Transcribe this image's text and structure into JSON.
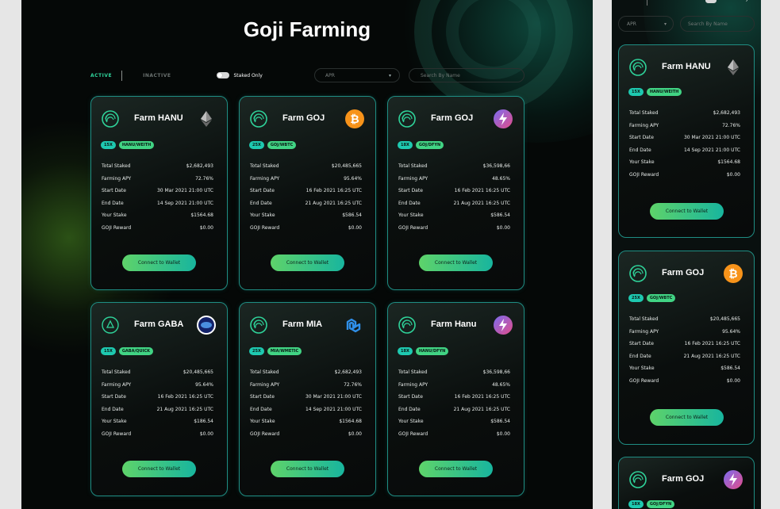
{
  "page": {
    "title": "Goji Farming"
  },
  "filters": {
    "active_label": "ACTIVE",
    "inactive_label": "INACTIVE",
    "staked_only_label": "Staked Only",
    "sort_value": "APR",
    "search_placeholder": "Search By Name"
  },
  "row_labels": {
    "total_staked": "Total Staked",
    "farming_apy": "Farming APY",
    "start_date": "Start Date",
    "end_date": "End Date",
    "your_stake": "Your Stake",
    "goji_reward": "GOJI Reward"
  },
  "connect_label": "Connect to Wallet",
  "cards": [
    {
      "name": "Farm HANU",
      "multiplier": "15X",
      "pair": "HANU/WEITH",
      "token_icon": "ethereum-icon",
      "total_staked": "$2,682,493",
      "farming_apy": "72.76%",
      "start_date": "30 Mar 2021 21:00 UTC",
      "end_date": "14 Sep 2021 21:00 UTC",
      "your_stake": "$1564.68",
      "goji_reward": "$0.00"
    },
    {
      "name": "Farm GOJ",
      "multiplier": "25X",
      "pair": "GOJ/WBTC",
      "token_icon": "bitcoin-icon",
      "total_staked": "$20,485,665",
      "farming_apy": "95.64%",
      "start_date": "16 Feb 2021 16:25 UTC",
      "end_date": "21 Aug 2021 16:25 UTC",
      "your_stake": "$586.54",
      "goji_reward": "$0.00"
    },
    {
      "name": "Farm GOJ",
      "multiplier": "18X",
      "pair": "GOJ/DFYN",
      "token_icon": "dfyn-icon",
      "total_staked": "$36,598,66",
      "farming_apy": "48.65%",
      "start_date": "16 Feb 2021 16:25 UTC",
      "end_date": "21 Aug 2021 16:25 UTC",
      "your_stake": "$586.54",
      "goji_reward": "$0.00"
    },
    {
      "name": "Farm GABA",
      "multiplier": "15X",
      "pair": "GABA/QUICK",
      "token_icon": "quickswap-icon",
      "total_staked": "$20,485,665",
      "farming_apy": "95.64%",
      "start_date": "16 Feb 2021 16:25 UTC",
      "end_date": "21 Aug 2021 16:25 UTC",
      "your_stake": "$186.54",
      "goji_reward": "$0.00"
    },
    {
      "name": "Farm MIA",
      "multiplier": "25X",
      "pair": "MIA/WMETIC",
      "token_icon": "polygon-icon",
      "total_staked": "$2,682,493",
      "farming_apy": "72.76%",
      "start_date": "30 Mar 2021 21:00 UTC",
      "end_date": "14 Sep 2021 21:00 UTC",
      "your_stake": "$1564.68",
      "goji_reward": "$0.00"
    },
    {
      "name": "Farm Hanu",
      "multiplier": "18X",
      "pair": "HANU/DFYN",
      "token_icon": "dfyn-icon",
      "total_staked": "$36,598,66",
      "farming_apy": "48.65%",
      "start_date": "16 Feb 2021 16:25 UTC",
      "end_date": "21 Aug 2021 16:25 UTC",
      "your_stake": "$586.54",
      "goji_reward": "$0.00"
    }
  ],
  "mobile": {
    "cards": [
      {
        "name": "Farm HANU",
        "multiplier": "15X",
        "pair": "HANU/WEITH",
        "token_icon": "ethereum-icon",
        "total_staked": "$2,682,493",
        "farming_apy": "72.76%",
        "start_date": "30 Mar 2021 21:00 UTC",
        "end_date": "14 Sep 2021 21:00 UTC",
        "your_stake": "$1564.68",
        "goji_reward": "$0.00"
      },
      {
        "name": "Farm GOJ",
        "multiplier": "25X",
        "pair": "GOJ/WBTC",
        "token_icon": "bitcoin-icon",
        "total_staked": "$20,485,665",
        "farming_apy": "95.64%",
        "start_date": "16 Feb 2021 16:25 UTC",
        "end_date": "21 Aug 2021 16:25 UTC",
        "your_stake": "$586.54",
        "goji_reward": "$0.00"
      },
      {
        "name": "Farm GOJ",
        "multiplier": "18X",
        "pair": "GOJ/DFYN",
        "token_icon": "dfyn-icon"
      }
    ]
  },
  "colors": {
    "accent": "#2fd39a",
    "card_border": "#1f8d83",
    "button_start": "#5ed36a",
    "button_end": "#18b59e",
    "bitcoin": "#f7931a",
    "polygon": "#2f8fe8"
  }
}
